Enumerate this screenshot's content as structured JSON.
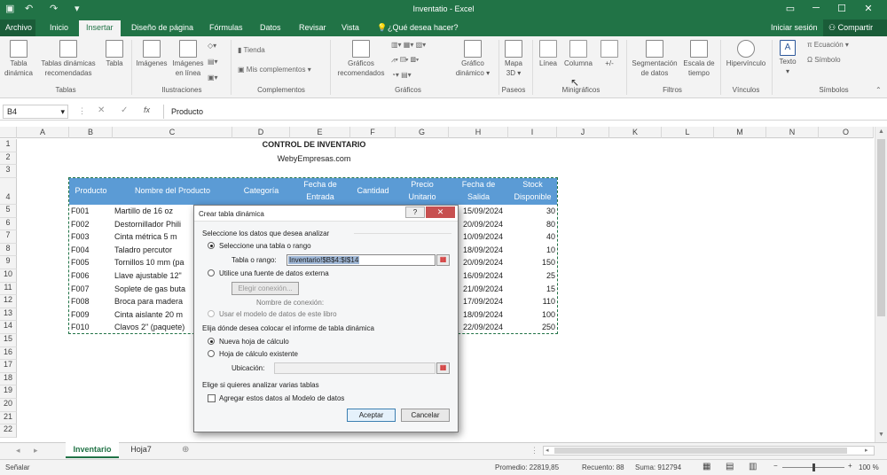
{
  "window": {
    "title": "Inventatio - Excel"
  },
  "tabs": [
    "Archivo",
    "Inicio",
    "Insertar",
    "Diseño de página",
    "Fórmulas",
    "Datos",
    "Revisar",
    "Vista"
  ],
  "tell_me": "¿Qué desea hacer?",
  "signin": "Iniciar sesión",
  "share": "Compartir",
  "ribbon": {
    "tabla_dinamica": [
      "Tabla",
      "dinámica"
    ],
    "tablas_recomendadas": [
      "Tablas dinámicas",
      "recomendadas"
    ],
    "tabla": "Tabla",
    "imagenes": "Imágenes",
    "imagenes_linea": [
      "Imágenes",
      "en línea"
    ],
    "tienda": "Tienda",
    "mis_complementos": "Mis complementos",
    "graficos_recomendados": [
      "Gráficos",
      "recomendados"
    ],
    "grafico_dinamico": [
      "Gráfico",
      "dinámico"
    ],
    "mapa_3d": [
      "Mapa",
      "3D"
    ],
    "linea": "Línea",
    "columna": "Columna",
    "ganancia": "+/-",
    "segmentacion": [
      "Segmentación",
      "de datos"
    ],
    "escala_tiempo": [
      "Escala de",
      "tiempo"
    ],
    "hipervinculo": "Hipervínculo",
    "texto": "Texto",
    "ecuacion": "Ecuación",
    "simbolo": "Símbolo",
    "groups": {
      "tablas": "Tablas",
      "ilustraciones": "Ilustraciones",
      "complementos": "Complementos",
      "graficos": "Gráficos",
      "paseos": "Paseos",
      "minigraficos": "Minigráficos",
      "filtros": "Filtros",
      "vinculos": "Vínculos",
      "simbolos": "Símbolos"
    }
  },
  "formula_bar": {
    "name_box": "B4",
    "fx": "fx",
    "value": "Producto"
  },
  "columns": [
    "A",
    "B",
    "C",
    "D",
    "E",
    "F",
    "G",
    "H",
    "I",
    "J",
    "K",
    "L",
    "M",
    "N",
    "O"
  ],
  "rows": [
    "1",
    "2",
    "3",
    "4",
    "5",
    "6",
    "7",
    "8",
    "9",
    "10",
    "11",
    "12",
    "13",
    "14",
    "15",
    "16",
    "17",
    "18",
    "19",
    "20",
    "21",
    "22"
  ],
  "sheet": {
    "title": "CONTROL DE INVENTARIO",
    "subtitle": "WebyEmpresas.com",
    "headers": {
      "producto": "Producto",
      "nombre": "Nombre del Producto",
      "categoria": "Categoría",
      "fecha_entrada": [
        "Fecha de",
        "Entrada"
      ],
      "cantidad": "Cantidad",
      "precio": [
        "Precio",
        "Unitario"
      ],
      "fecha_salida": [
        "Fecha de",
        "Salida"
      ],
      "stock": [
        "Stock",
        "Disponible"
      ]
    },
    "rows": [
      {
        "codigo": "F001",
        "nombre": "Martillo de 16 oz",
        "salida": "15/09/2024",
        "stock": "30"
      },
      {
        "codigo": "F002",
        "nombre": "Destornillador Phili",
        "salida": "20/09/2024",
        "stock": "80"
      },
      {
        "codigo": "F003",
        "nombre": "Cinta métrica 5 m",
        "salida": "10/09/2024",
        "stock": "40"
      },
      {
        "codigo": "F004",
        "nombre": "Taladro percutor",
        "salida": "18/09/2024",
        "stock": "10"
      },
      {
        "codigo": "F005",
        "nombre": "Tornillos 10 mm (pa",
        "salida": "20/09/2024",
        "stock": "150"
      },
      {
        "codigo": "F006",
        "nombre": "Llave ajustable 12\"",
        "salida": "16/09/2024",
        "stock": "25"
      },
      {
        "codigo": "F007",
        "nombre": "Soplete de gas buta",
        "salida": "21/09/2024",
        "stock": "15"
      },
      {
        "codigo": "F008",
        "nombre": "Broca para madera",
        "salida": "17/09/2024",
        "stock": "110"
      },
      {
        "codigo": "F009",
        "nombre": "Cinta aislante 20 m",
        "salida": "18/09/2024",
        "stock": "100"
      },
      {
        "codigo": "F010",
        "nombre": "Clavos 2\" (paquete)",
        "salida": "22/09/2024",
        "stock": "250"
      }
    ]
  },
  "dialog": {
    "title": "Crear tabla dinámica",
    "help": "?",
    "section1": "Seleccione los datos que desea analizar",
    "opt_table": "Seleccione una tabla o rango",
    "range_label": "Tabla o rango:",
    "range_value": "Inventario!$B$4:$I$14",
    "opt_external": "Utilice una fuente de datos externa",
    "choose_conn": "Elegir conexión...",
    "conn_name": "Nombre de conexión:",
    "opt_model": "Usar el modelo de datos de este libro",
    "section2": "Elija dónde desea colocar el informe de tabla dinámica",
    "opt_new": "Nueva hoja de cálculo",
    "opt_existing": "Hoja de cálculo existente",
    "location_label": "Ubicación:",
    "section3": "Elige si quieres analizar varias tablas",
    "add_model": "Agregar estos datos al Modelo de datos",
    "ok": "Aceptar",
    "cancel": "Cancelar"
  },
  "sheet_tabs": [
    "Inventario",
    "Hoja7"
  ],
  "status": {
    "mode": "Señalar",
    "promedio": "Promedio: 22819,85",
    "recuento": "Recuento: 88",
    "suma": "Suma: 912794",
    "zoom": "100 %"
  },
  "colors": {
    "excel_green": "#217346",
    "table_header": "#5b9bd5"
  }
}
